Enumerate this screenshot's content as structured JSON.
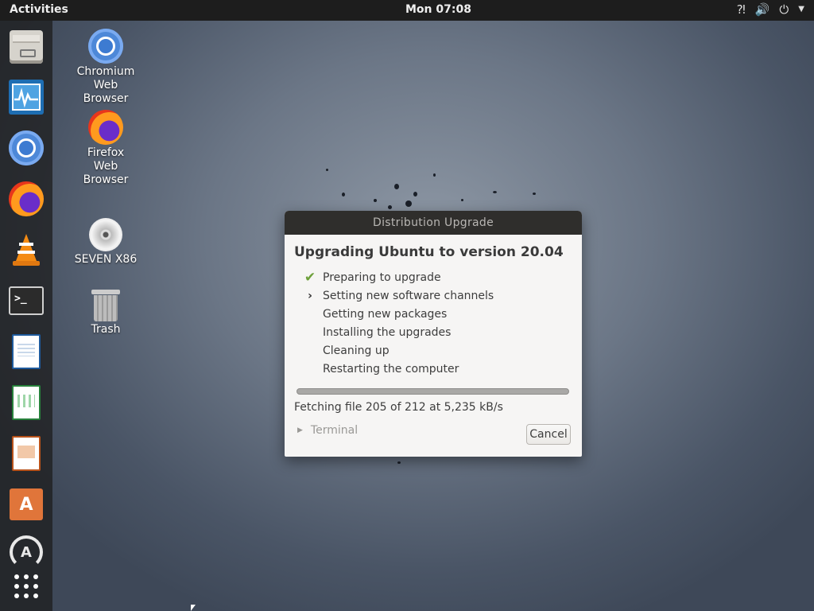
{
  "topbar": {
    "activities": "Activities",
    "clock": "Mon 07:08",
    "tray_icons": [
      "network-question-icon",
      "volume-icon",
      "power-icon",
      "menu-down-arrow-icon"
    ]
  },
  "dock": {
    "items": [
      {
        "name": "files-icon"
      },
      {
        "name": "system-monitor-icon"
      },
      {
        "name": "chromium-icon"
      },
      {
        "name": "firefox-icon"
      },
      {
        "name": "vlc-icon"
      },
      {
        "name": "terminal-icon",
        "glyph": ">_"
      },
      {
        "name": "libreoffice-writer-icon"
      },
      {
        "name": "libreoffice-calc-icon"
      },
      {
        "name": "libreoffice-impress-icon"
      },
      {
        "name": "software-center-icon",
        "glyph": "A"
      },
      {
        "name": "software-updater-icon",
        "glyph": "A"
      },
      {
        "name": "show-applications-icon"
      }
    ]
  },
  "desktop": {
    "icons": [
      {
        "name": "chromium-desktop-icon",
        "lines": [
          "Chromium",
          "Web",
          "Browser"
        ]
      },
      {
        "name": "firefox-desktop-icon",
        "lines": [
          "Firefox",
          "Web",
          "Browser"
        ]
      },
      {
        "name": "cd-drive-icon",
        "lines": [
          "SEVEN X86"
        ]
      },
      {
        "name": "trash-icon",
        "lines": [
          "Trash"
        ]
      }
    ]
  },
  "dialog": {
    "title": "Distribution Upgrade",
    "heading": "Upgrading Ubuntu to version 20.04",
    "steps": [
      {
        "label": "Preparing to upgrade",
        "state": "done"
      },
      {
        "label": "Setting new software channels",
        "state": "current"
      },
      {
        "label": "Getting new packages",
        "state": "pending"
      },
      {
        "label": "Installing the upgrades",
        "state": "pending"
      },
      {
        "label": "Cleaning up",
        "state": "pending"
      },
      {
        "label": "Restarting the computer",
        "state": "pending"
      }
    ],
    "progress_percent": 0,
    "status": "Fetching file 205 of 212 at 5,235 kB/s",
    "terminal_label": "Terminal",
    "cancel_label": "Cancel"
  },
  "colors": {
    "topbar": "#1d1d1d",
    "dialog_titlebar": "#2f2e2c",
    "check": "#6da03a",
    "dialog_bg": "#f6f5f4"
  }
}
